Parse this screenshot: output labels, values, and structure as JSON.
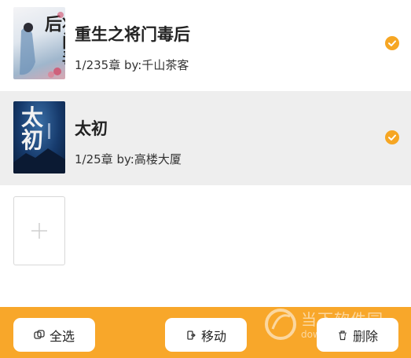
{
  "books": [
    {
      "title": "重生之将门毒后",
      "meta": "1/235章 by:千山茶客",
      "cover_text": "将门毒后",
      "selected": true
    },
    {
      "title": "太初",
      "meta": "1/25章 by:高楼大厦",
      "cover_text": "太初",
      "selected": true
    }
  ],
  "toolbar": {
    "select_all_label": "全选",
    "move_label": "移动",
    "delete_label": "删除"
  },
  "watermark": {
    "text": "当下软件园",
    "url": "downxia.com"
  },
  "colors": {
    "accent": "#f8a72a",
    "check": "#f6a623"
  }
}
